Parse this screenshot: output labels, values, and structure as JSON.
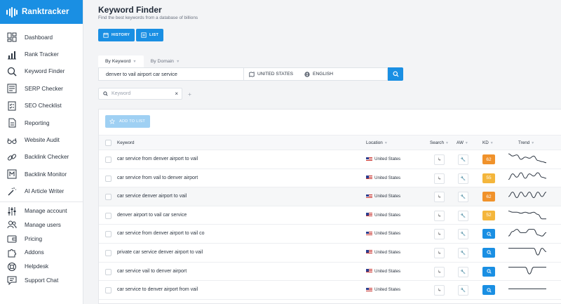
{
  "app": {
    "name": "Ranktracker"
  },
  "sidebar": {
    "items": [
      {
        "label": "Dashboard",
        "icon": "dashboard-icon"
      },
      {
        "label": "Rank Tracker",
        "icon": "bar-chart-icon"
      },
      {
        "label": "Keyword Finder",
        "icon": "keyword-search-icon"
      },
      {
        "label": "SERP Checker",
        "icon": "serp-icon"
      },
      {
        "label": "SEO Checklist",
        "icon": "checklist-icon"
      },
      {
        "label": "Reporting",
        "icon": "report-icon"
      },
      {
        "label": "Website Audit",
        "icon": "glasses-icon"
      },
      {
        "label": "Backlink Checker",
        "icon": "link-icon"
      },
      {
        "label": "Backlink Monitor",
        "icon": "monitor-icon"
      },
      {
        "label": "AI Article Writer",
        "icon": "magic-wand-icon"
      }
    ],
    "account_items": [
      {
        "label": "Manage account",
        "icon": "sliders-icon"
      },
      {
        "label": "Manage users",
        "icon": "users-icon"
      },
      {
        "label": "Pricing",
        "icon": "wallet-icon"
      },
      {
        "label": "Addons",
        "icon": "puzzle-icon"
      },
      {
        "label": "Helpdesk",
        "icon": "lifebuoy-icon"
      },
      {
        "label": "Support Chat",
        "icon": "chat-icon"
      }
    ]
  },
  "header": {
    "title": "Keyword Finder",
    "subtitle": "Find the best keywords from a database of billions",
    "history_label": "HISTORY",
    "list_label": "LIST"
  },
  "tabs": [
    {
      "label": "By Keyword"
    },
    {
      "label": "By Domain"
    }
  ],
  "search": {
    "query": "denver to vail airport car service",
    "country": "UNITED STATES",
    "language": "ENGLISH"
  },
  "filter": {
    "placeholder": "Keyword"
  },
  "table": {
    "add_to_list": "ADD TO LIST",
    "columns": {
      "keyword": "Keyword",
      "location": "Location",
      "search": "Search",
      "aw": "AW",
      "kd": "KD",
      "trend": "Trend"
    },
    "colors": {
      "kd_orange": "#f0922b",
      "kd_yellow": "#f4b63c",
      "kd_blue": "#1a8fe3"
    },
    "rows": [
      {
        "keyword": "car service from denver airport to vail",
        "location": "United States",
        "kd": "62",
        "kd_color": "#f0922b",
        "trend": [
          10,
          8,
          9,
          5,
          7,
          6,
          8,
          4,
          3,
          2
        ]
      },
      {
        "keyword": "car service from vail to denver airport",
        "location": "United States",
        "kd": "55",
        "kd_color": "#f4b63c",
        "trend": [
          4,
          9,
          6,
          10,
          5,
          9,
          7,
          10,
          6,
          5
        ]
      },
      {
        "keyword": "car service denver airport to vail",
        "location": "United States",
        "kd": "62",
        "kd_color": "#f0922b",
        "trend": [
          5,
          9,
          4,
          9,
          5,
          9,
          4,
          9,
          5,
          9
        ]
      },
      {
        "keyword": "denver airport to vail car service",
        "location": "United States",
        "kd": "52",
        "kd_color": "#f4b63c",
        "trend": [
          9,
          8,
          8,
          7,
          8,
          7,
          8,
          6,
          2,
          2
        ]
      },
      {
        "keyword": "car service from denver airport to vail co",
        "location": "United States",
        "kd": "",
        "kd_color": "#1a8fe3",
        "trend": [
          3,
          7,
          9,
          6,
          6,
          9,
          9,
          4,
          3,
          6
        ]
      },
      {
        "keyword": "private car service denver airport to vail",
        "location": "United States",
        "kd": "",
        "kd_color": "#1a8fe3",
        "trend": [
          9,
          9,
          9,
          9,
          9,
          9,
          9,
          3,
          9,
          6
        ]
      },
      {
        "keyword": "car service vail to denver airport",
        "location": "United States",
        "kd": "",
        "kd_color": "#1a8fe3",
        "trend": [
          9,
          9,
          9,
          9,
          9,
          3,
          9,
          9,
          9,
          9
        ]
      },
      {
        "keyword": "car service to denver airport from vail",
        "location": "United States",
        "kd": "",
        "kd_color": "#1a8fe3",
        "trend": [
          6,
          6,
          6,
          6,
          6,
          6,
          6,
          6,
          6,
          6
        ]
      }
    ]
  }
}
